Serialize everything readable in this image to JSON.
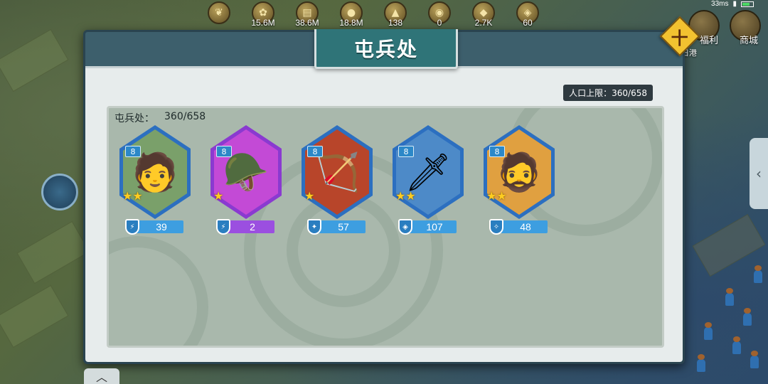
{
  "status": {
    "ping": "33ms"
  },
  "resources": [
    {
      "icon": "wheat-icon",
      "glyph": "❦",
      "value": ""
    },
    {
      "icon": "grain-icon",
      "glyph": "✿",
      "value": "15.6M"
    },
    {
      "icon": "wood-icon",
      "glyph": "▤",
      "value": "38.6M"
    },
    {
      "icon": "stone-icon",
      "glyph": "●",
      "value": "18.8M"
    },
    {
      "icon": "iron-icon",
      "glyph": "▲",
      "value": "138"
    },
    {
      "icon": "gold-icon",
      "glyph": "◉",
      "value": "0"
    },
    {
      "icon": "gem-icon",
      "glyph": "◆",
      "value": "2.7K"
    },
    {
      "icon": "token-icon",
      "glyph": "◈",
      "value": "60"
    }
  ],
  "topright": {
    "shop_label": "商城",
    "welfare_label": "福利",
    "port_label": "日港"
  },
  "dialog": {
    "title": "屯兵处",
    "close_glyph": "十",
    "capacity_label": "人口上限：360/658",
    "count_label": "屯兵处：",
    "count_value": "360/658"
  },
  "units": [
    {
      "level": "8",
      "count": "39",
      "frame": "#2c6fc0",
      "badge": "#3d9ee0",
      "stars": "★★",
      "portrait": "🧑",
      "bg": "#7aa06a",
      "shield": "⚡"
    },
    {
      "level": "8",
      "count": "2",
      "frame": "#8a3ad0",
      "badge": "#9b4fe0",
      "stars": "★",
      "portrait": "🪖",
      "bg": "#c34ad6",
      "shield": "⚡"
    },
    {
      "level": "8",
      "count": "57",
      "frame": "#2c6fc0",
      "badge": "#3d9ee0",
      "stars": "★",
      "portrait": "🏹",
      "bg": "#b8452a",
      "shield": "✦"
    },
    {
      "level": "8",
      "count": "107",
      "frame": "#2c6fc0",
      "badge": "#3d9ee0",
      "stars": "★★",
      "portrait": "🗡",
      "bg": "#4d8ac8",
      "shield": "◈"
    },
    {
      "level": "8",
      "count": "48",
      "frame": "#2c6fc0",
      "badge": "#3d9ee0",
      "stars": "★★",
      "portrait": "🧔",
      "bg": "#e0a040",
      "shield": "✧"
    }
  ],
  "side_tab_glyph": "‹",
  "bottom_tab_glyph": "︿"
}
